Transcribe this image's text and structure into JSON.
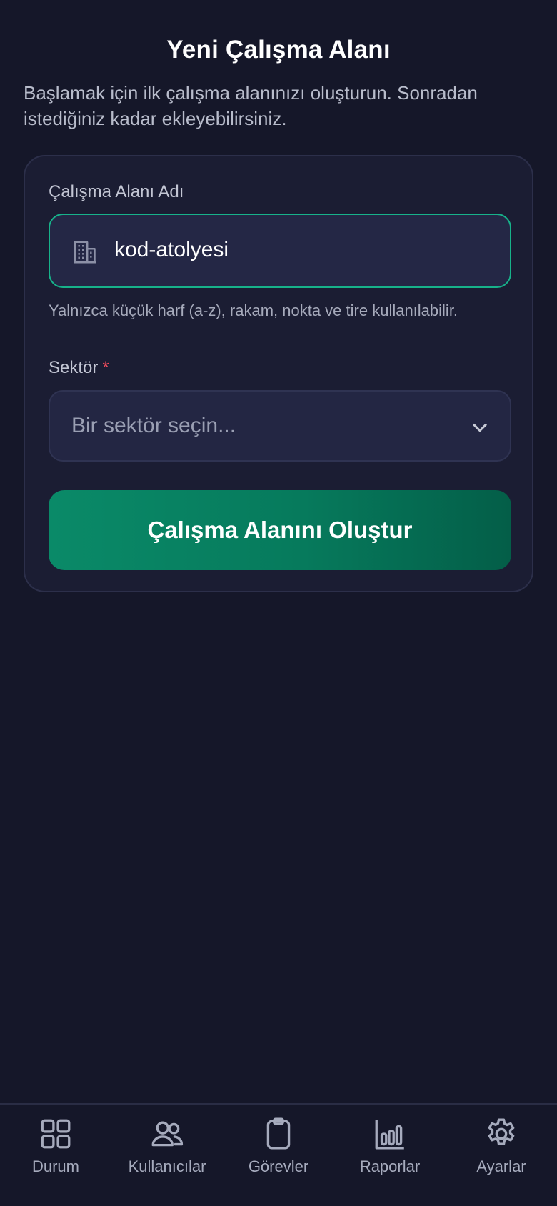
{
  "header": {
    "title": "Yeni Çalışma Alanı",
    "subtitle": "Başlamak için ilk çalışma alanınızı oluşturun. Sonradan istediğiniz kadar ekleyebilirsiniz."
  },
  "form": {
    "workspace_name_label": "Çalışma Alanı Adı",
    "workspace_name_value": "kod-atolyesi",
    "workspace_name_icon": "building-icon",
    "workspace_name_hint": "Yalnızca küçük harf (a-z), rakam, nokta ve tire kullanılabilir.",
    "sector_label": "Sektör",
    "sector_required_mark": "*",
    "sector_placeholder": "Bir sektör seçin...",
    "submit_label": "Çalışma Alanını Oluştur"
  },
  "colors": {
    "background": "#151729",
    "card": "#1b1d33",
    "accent": "#17b28a",
    "primary_button": "#0a8a68",
    "required": "#ef4b5c"
  },
  "nav": {
    "items": [
      {
        "label": "Durum",
        "icon": "grid-icon"
      },
      {
        "label": "Kullanıcılar",
        "icon": "users-icon"
      },
      {
        "label": "Görevler",
        "icon": "clipboard-icon"
      },
      {
        "label": "Raporlar",
        "icon": "bar-chart-icon"
      },
      {
        "label": "Ayarlar",
        "icon": "gear-icon"
      }
    ]
  }
}
